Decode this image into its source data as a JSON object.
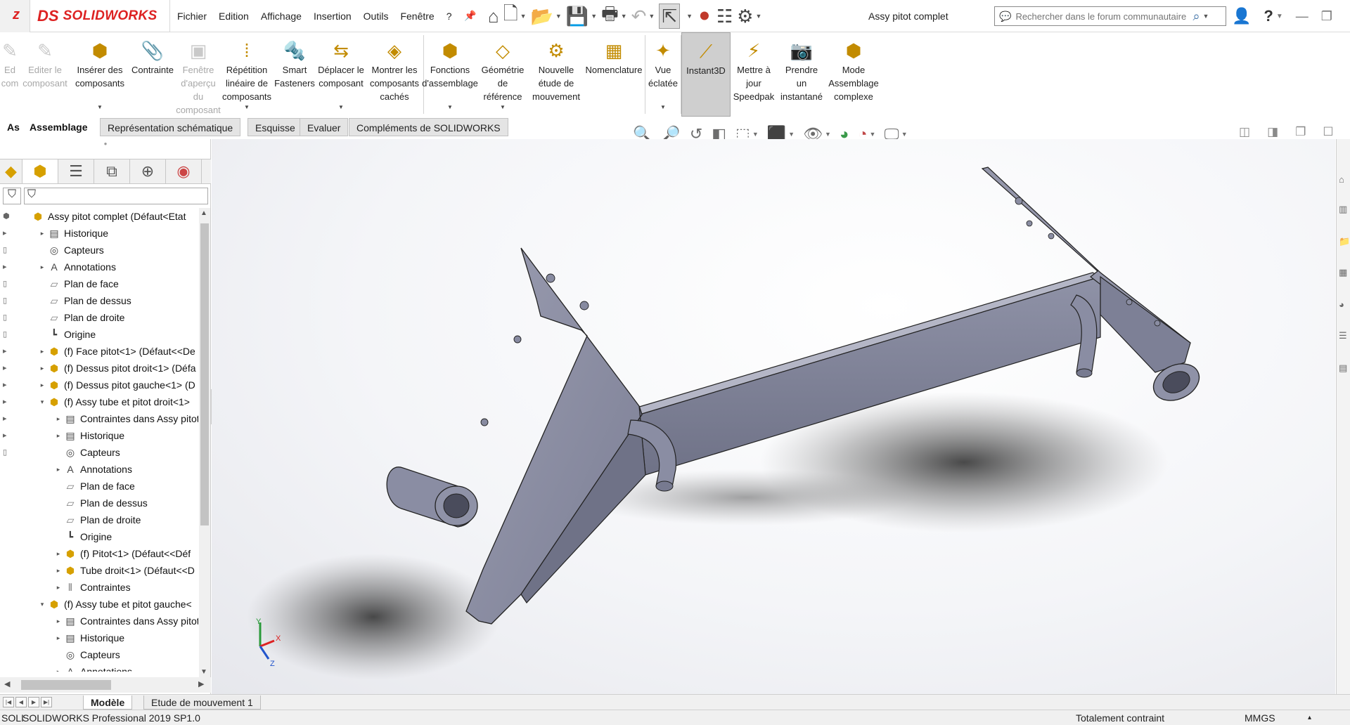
{
  "app": {
    "logo_prefix": "DS",
    "logo_text": "SOLIDWORKS",
    "logo_tab": "z"
  },
  "menu": [
    "Fichier",
    "Edition",
    "Affichage",
    "Insertion",
    "Outils",
    "Fenêtre",
    "?"
  ],
  "document_title": "Assy pitot complet",
  "search": {
    "placeholder": "Rechercher dans le forum communautaire"
  },
  "command_manager": [
    {
      "id": "edit-component-short",
      "label": "Ed\ncom",
      "icon": "edit-icon",
      "disabled": true
    },
    {
      "id": "edit-component",
      "label": "Editer le\ncomposant",
      "icon": "edit-component-icon",
      "disabled": true
    },
    {
      "id": "insert-components",
      "label": "Insérer des\ncomposants",
      "icon": "insert-components-icon",
      "dropdown": true
    },
    {
      "id": "mate",
      "label": "Contrainte",
      "icon": "paperclip-icon"
    },
    {
      "id": "component-preview",
      "label": "Fenêtre\nd'aperçu du\ncomposant",
      "icon": "preview-window-icon",
      "disabled": true
    },
    {
      "id": "linear-pattern",
      "label": "Répétition\nlinéaire de\ncomposants",
      "icon": "linear-pattern-icon",
      "dropdown": true
    },
    {
      "id": "smart-fasteners",
      "label": "Smart\nFasteners",
      "icon": "fastener-icon"
    },
    {
      "id": "move-component",
      "label": "Déplacer le\ncomposant",
      "icon": "move-component-icon",
      "dropdown": true
    },
    {
      "id": "show-hidden",
      "label": "Montrer les\ncomposants\ncachés",
      "icon": "show-hidden-icon"
    },
    {
      "id": "assembly-features",
      "label": "Fonctions\nd'assemblage",
      "icon": "assembly-features-icon",
      "dropdown": true
    },
    {
      "id": "reference-geometry",
      "label": "Géométrie\nde\nréférence",
      "icon": "reference-geometry-icon",
      "dropdown": true
    },
    {
      "id": "new-motion-study",
      "label": "Nouvelle\nétude de\nmouvement",
      "icon": "motion-study-icon"
    },
    {
      "id": "bom",
      "label": "Nomenclature",
      "icon": "bom-icon"
    },
    {
      "id": "exploded-view",
      "label": "Vue\néclatée",
      "icon": "exploded-view-icon",
      "dropdown": true
    },
    {
      "id": "instant3d",
      "label": "Instant3D",
      "icon": "instant3d-icon",
      "active": true
    },
    {
      "id": "update-speedpak",
      "label": "Mettre à\njour\nSpeedpak",
      "icon": "speedpak-icon"
    },
    {
      "id": "snapshot",
      "label": "Prendre\nun\ninstantané",
      "icon": "camera-icon"
    },
    {
      "id": "large-assembly",
      "label": "Mode\nAssemblage\ncomplexe",
      "icon": "large-assembly-icon"
    }
  ],
  "tabs": {
    "prefix": "As",
    "active": "Assemblage",
    "others": [
      "Représentation schématique",
      "Esquisse",
      "Evaluer",
      "Compléments de SOLIDWORKS"
    ]
  },
  "feature_tree": [
    {
      "level": 0,
      "text": "Assy pitot complet  (Défaut<Etat",
      "icon": "assembly",
      "arrow": ""
    },
    {
      "level": 1,
      "text": "Historique",
      "icon": "history",
      "arrow": "▸"
    },
    {
      "level": 1,
      "text": "Capteurs",
      "icon": "sensor",
      "arrow": ""
    },
    {
      "level": 1,
      "text": "Annotations",
      "icon": "annotation",
      "arrow": "▸"
    },
    {
      "level": 1,
      "text": "Plan de face",
      "icon": "plane",
      "arrow": ""
    },
    {
      "level": 1,
      "text": "Plan de dessus",
      "icon": "plane",
      "arrow": ""
    },
    {
      "level": 1,
      "text": "Plan de droite",
      "icon": "plane",
      "arrow": ""
    },
    {
      "level": 1,
      "text": "Origine",
      "icon": "origin",
      "arrow": ""
    },
    {
      "level": 1,
      "text": "(f) Face pitot<1> (Défaut<<De",
      "icon": "part",
      "arrow": "▸"
    },
    {
      "level": 1,
      "text": "(f) Dessus pitot droit<1> (Défa",
      "icon": "part",
      "arrow": "▸"
    },
    {
      "level": 1,
      "text": "(f) Dessus pitot gauche<1> (D",
      "icon": "part",
      "arrow": "▸"
    },
    {
      "level": 1,
      "text": "(f) Assy tube et pitot droit<1>",
      "icon": "assembly",
      "arrow": "▾"
    },
    {
      "level": 2,
      "text": "Contraintes dans Assy pitot",
      "icon": "mate-folder",
      "arrow": "▸"
    },
    {
      "level": 2,
      "text": "Historique",
      "icon": "history",
      "arrow": "▸"
    },
    {
      "level": 2,
      "text": "Capteurs",
      "icon": "sensor",
      "arrow": ""
    },
    {
      "level": 2,
      "text": "Annotations",
      "icon": "annotation",
      "arrow": "▸"
    },
    {
      "level": 2,
      "text": "Plan de face",
      "icon": "plane",
      "arrow": ""
    },
    {
      "level": 2,
      "text": "Plan de dessus",
      "icon": "plane",
      "arrow": ""
    },
    {
      "level": 2,
      "text": "Plan de droite",
      "icon": "plane",
      "arrow": ""
    },
    {
      "level": 2,
      "text": "Origine",
      "icon": "origin",
      "arrow": ""
    },
    {
      "level": 2,
      "text": "(f) Pitot<1> (Défaut<<Déf",
      "icon": "part",
      "arrow": "▸"
    },
    {
      "level": 2,
      "text": "Tube droit<1> (Défaut<<D",
      "icon": "part",
      "arrow": "▸"
    },
    {
      "level": 2,
      "text": "Contraintes",
      "icon": "mates",
      "arrow": "▸"
    },
    {
      "level": 1,
      "text": "(f) Assy tube et pitot gauche<",
      "icon": "assembly",
      "arrow": "▾"
    },
    {
      "level": 2,
      "text": "Contraintes dans Assy pitot",
      "icon": "mate-folder",
      "arrow": "▸"
    },
    {
      "level": 2,
      "text": "Historique",
      "icon": "history",
      "arrow": "▸"
    },
    {
      "level": 2,
      "text": "Capteurs",
      "icon": "sensor",
      "arrow": ""
    },
    {
      "level": 2,
      "text": "Annotations",
      "icon": "annotation",
      "arrow": "▸"
    }
  ],
  "triad": {
    "x": "X",
    "y": "Y",
    "z": "Z"
  },
  "bottom_tabs": {
    "active": "Modèle",
    "other": "Etude de mouvement 1"
  },
  "status": {
    "prefix": "SOLI",
    "product": "SOLIDWORKS Professional 2019 SP1.0",
    "state": "Totalement contraint",
    "units": "MMGS",
    "units_arrow": "▴"
  },
  "colors": {
    "brand": "#d22222",
    "active_tool": "#cfcfcf",
    "part_body": "#8c8fa3"
  }
}
